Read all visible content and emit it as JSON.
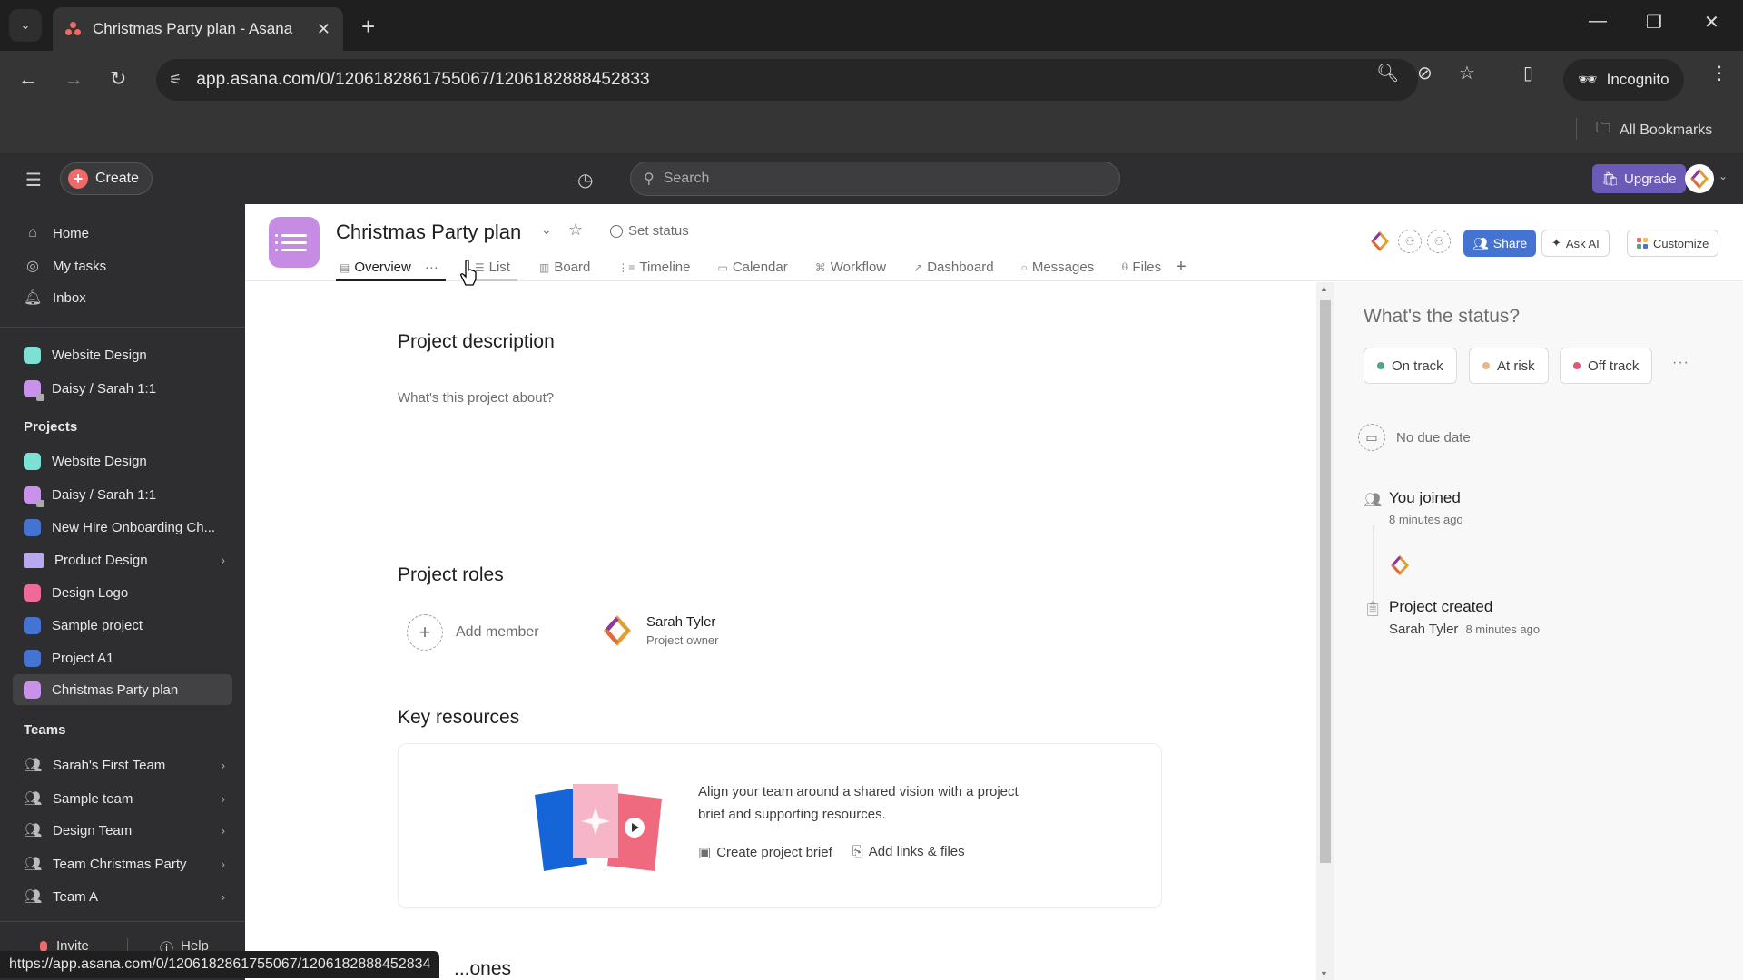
{
  "browser": {
    "tab_title": "Christmas Party plan - Asana",
    "url": "app.asana.com/0/1206182861755067/1206182888452833",
    "profile_label": "Incognito",
    "bookmarks_label": "All Bookmarks",
    "status_url": "https://app.asana.com/0/1206182861755067/1206182888452834"
  },
  "topbar": {
    "create_label": "Create",
    "search_placeholder": "Search",
    "upgrade_label": "Upgrade"
  },
  "sidebar": {
    "nav": [
      {
        "label": "Home",
        "icon": "home-icon"
      },
      {
        "label": "My tasks",
        "icon": "check-circle-icon"
      },
      {
        "label": "Inbox",
        "icon": "bell-icon"
      }
    ],
    "favorites": [
      {
        "label": "Website Design",
        "color": "#7ee0d4"
      },
      {
        "label": "Daisy / Sarah 1:1",
        "color": "#c891ea",
        "locked": true
      }
    ],
    "projects_heading": "Projects",
    "projects": [
      {
        "label": "Website Design",
        "color": "#7ee0d4"
      },
      {
        "label": "Daisy / Sarah 1:1",
        "color": "#c891ea",
        "locked": true
      },
      {
        "label": "New Hire Onboarding Ch...",
        "color": "#4573d2"
      },
      {
        "label": "Product Design",
        "color": "#b9a8f0",
        "folder": true
      },
      {
        "label": "Design Logo",
        "color": "#f06a99"
      },
      {
        "label": "Sample project",
        "color": "#4573d2"
      },
      {
        "label": "Project A1",
        "color": "#4573d2"
      },
      {
        "label": "Christmas Party plan",
        "color": "#c891ea",
        "active": true
      }
    ],
    "teams_heading": "Teams",
    "teams": [
      {
        "label": "Sarah's First Team"
      },
      {
        "label": "Sample team"
      },
      {
        "label": "Design Team"
      },
      {
        "label": "Team Christmas Party"
      },
      {
        "label": "Team A"
      }
    ],
    "footer": {
      "invite_label": "Invite",
      "help_label": "Help"
    }
  },
  "project": {
    "title": "Christmas Party plan",
    "set_status_label": "Set status",
    "tabs": [
      {
        "label": "Overview",
        "icon": "overview-icon",
        "active": true
      },
      {
        "label": "List",
        "icon": "list-icon"
      },
      {
        "label": "Board",
        "icon": "board-icon"
      },
      {
        "label": "Timeline",
        "icon": "timeline-icon"
      },
      {
        "label": "Calendar",
        "icon": "calendar-icon"
      },
      {
        "label": "Workflow",
        "icon": "workflow-icon"
      },
      {
        "label": "Dashboard",
        "icon": "dashboard-icon"
      },
      {
        "label": "Messages",
        "icon": "messages-icon"
      },
      {
        "label": "Files",
        "icon": "files-icon"
      }
    ],
    "share_label": "Share",
    "ask_ai_label": "Ask AI",
    "customize_label": "Customize"
  },
  "overview": {
    "description_heading": "Project description",
    "description_placeholder": "What's this project about?",
    "roles_heading": "Project roles",
    "add_member_label": "Add member",
    "owner": {
      "name": "Sarah Tyler",
      "role": "Project owner"
    },
    "resources_heading": "Key resources",
    "resources_text": "Align your team around a shared vision with a project brief and supporting resources.",
    "create_brief_label": "Create project brief",
    "add_links_label": "Add links & files",
    "next_heading_partial": "...ones"
  },
  "status_panel": {
    "title": "What's the status?",
    "options": [
      {
        "label": "On track",
        "color": "#4ea87a"
      },
      {
        "label": "At risk",
        "color": "#e8b88a"
      },
      {
        "label": "Off track",
        "color": "#e0577a"
      }
    ],
    "due_label": "No due date",
    "activity": [
      {
        "title": "You joined",
        "time": "8 minutes ago"
      },
      {
        "title": "Project created",
        "author": "Sarah Tyler",
        "time": "8 minutes ago"
      }
    ]
  }
}
